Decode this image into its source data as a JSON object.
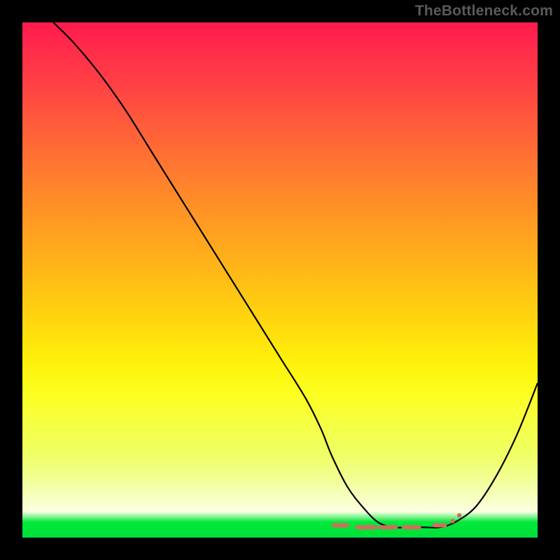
{
  "watermark": "TheBottleneck.com",
  "chart_data": {
    "type": "line",
    "title": "",
    "xlabel": "",
    "ylabel": "",
    "ylim": [
      0,
      100
    ],
    "xlim": [
      0,
      100
    ],
    "series": [
      {
        "name": "bottleneck-curve",
        "x": [
          6,
          10,
          15,
          20,
          25,
          30,
          35,
          40,
          45,
          50,
          55,
          58,
          60,
          63,
          66,
          69,
          72,
          75,
          78,
          81,
          84,
          88,
          92,
          96,
          100
        ],
        "y": [
          100,
          96,
          90,
          83,
          75,
          67,
          59,
          51,
          43,
          35,
          27,
          21,
          16,
          10,
          6,
          3,
          2,
          2,
          2,
          2,
          3,
          6,
          12,
          20,
          30
        ]
      }
    ],
    "markers": {
      "name": "optimal-range",
      "segments": [
        {
          "x0": 60.5,
          "x1": 63.0,
          "y": 2.4
        },
        {
          "x0": 65.0,
          "x1": 68.5,
          "y": 2.0
        },
        {
          "x0": 69.5,
          "x1": 72.5,
          "y": 2.0
        },
        {
          "x0": 74.0,
          "x1": 77.0,
          "y": 2.0
        },
        {
          "x0": 80.0,
          "x1": 82.0,
          "y": 2.4
        }
      ],
      "dots": [
        {
          "x": 83.5,
          "y": 3.2
        },
        {
          "x": 84.8,
          "y": 4.3
        }
      ]
    },
    "background_gradient": {
      "top": "#ff1a4d",
      "mid": "#ffeb0d",
      "bottom": "#00e03a"
    }
  }
}
